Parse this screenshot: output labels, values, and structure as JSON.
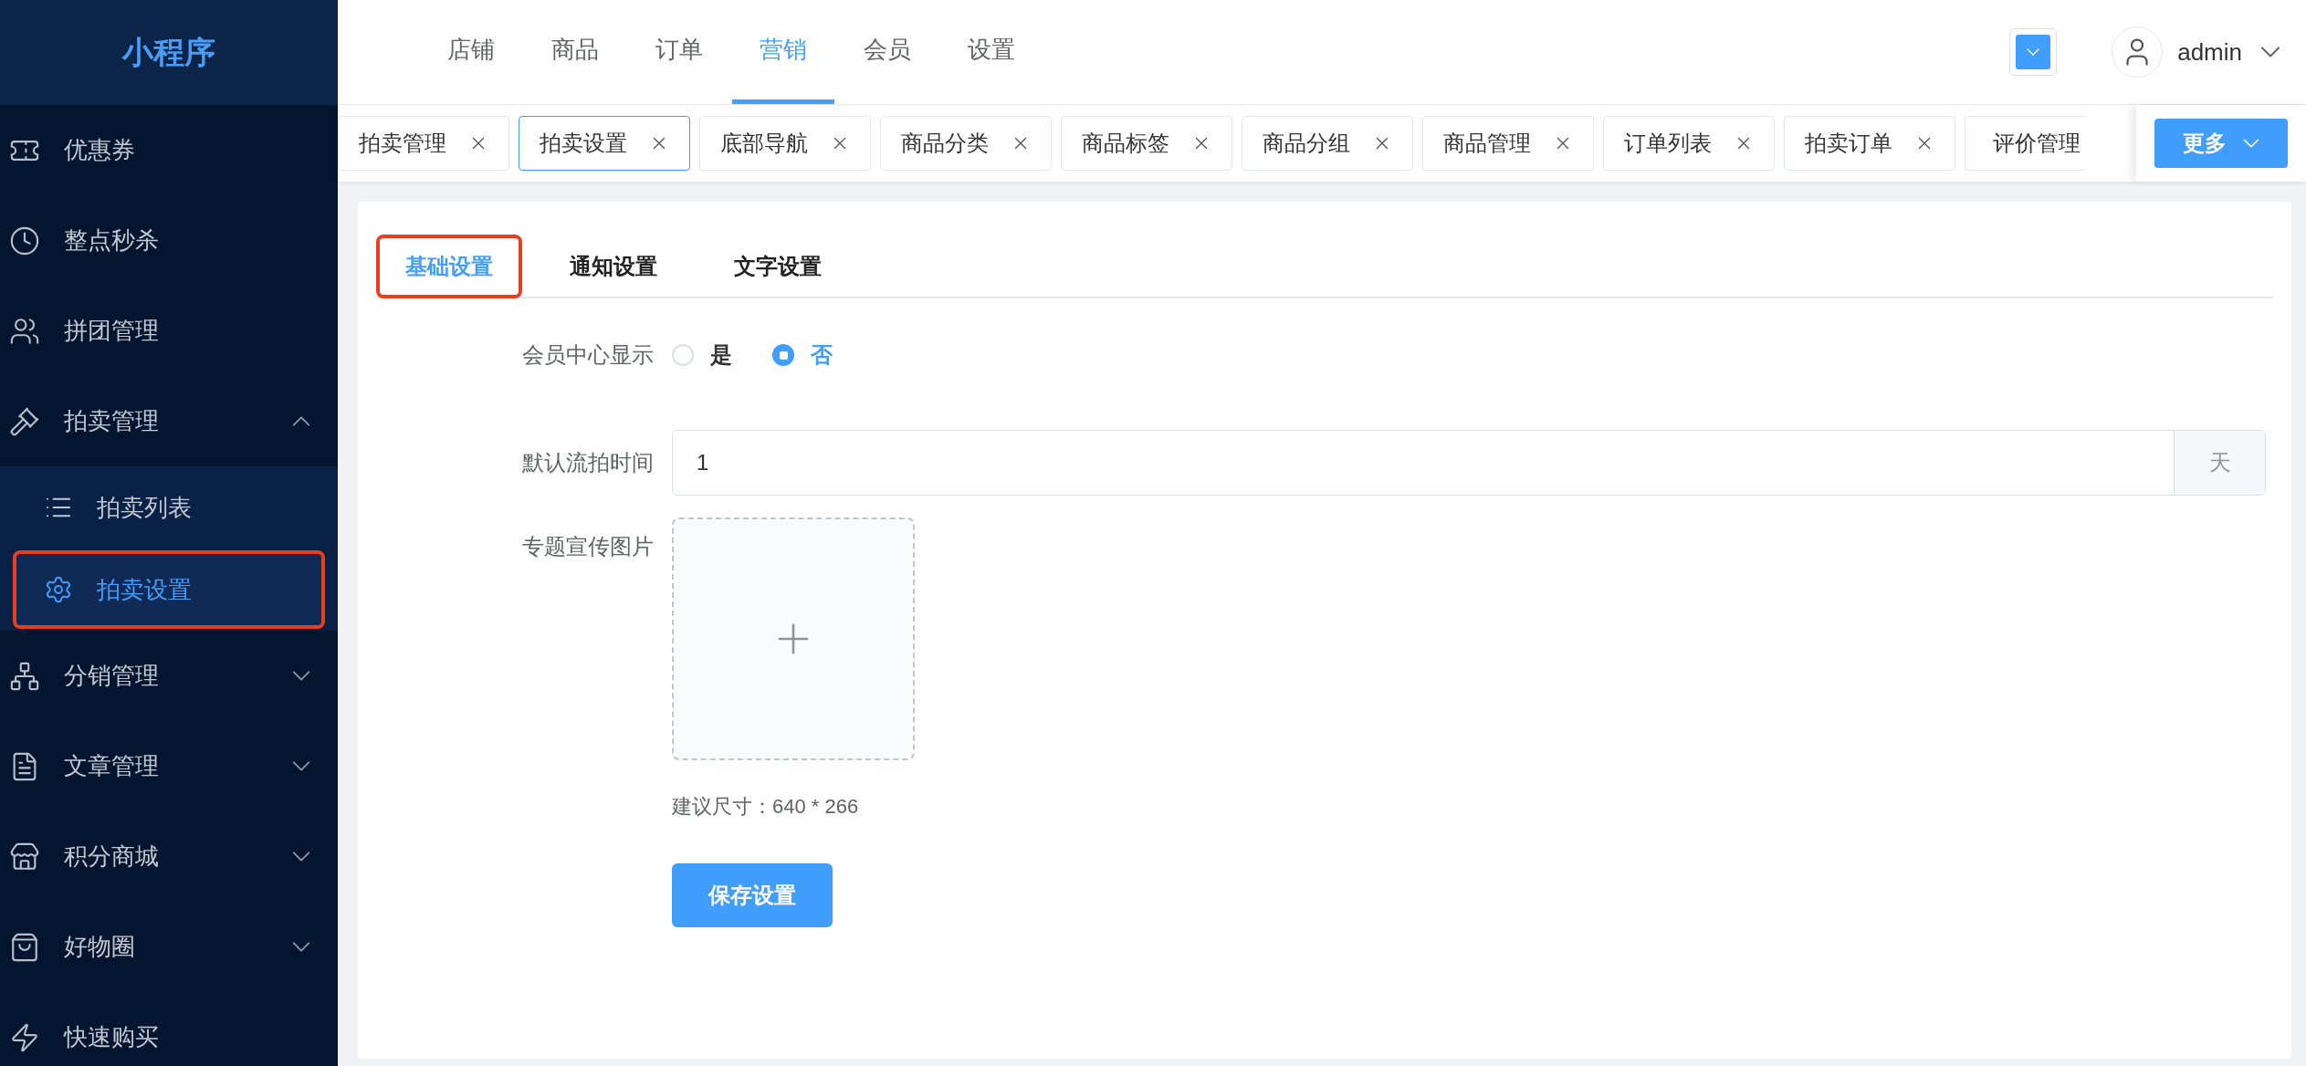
{
  "app": {
    "title": "小程序"
  },
  "sidebar": {
    "items": [
      {
        "label": "优惠券",
        "expandable": false
      },
      {
        "label": "整点秒杀",
        "expandable": false
      },
      {
        "label": "拼团管理",
        "expandable": false
      },
      {
        "label": "拍卖管理",
        "expanded": true,
        "expandable": true,
        "children": [
          {
            "label": "拍卖列表",
            "selected": false,
            "highlighted": false
          },
          {
            "label": "拍卖设置",
            "selected": true,
            "highlighted": true
          }
        ]
      },
      {
        "label": "分销管理",
        "expanded": false,
        "expandable": true
      },
      {
        "label": "文章管理",
        "expanded": false,
        "expandable": true
      },
      {
        "label": "积分商城",
        "expanded": false,
        "expandable": true
      },
      {
        "label": "好物圈",
        "expanded": false,
        "expandable": true
      },
      {
        "label": "快速购买",
        "expandable": false
      }
    ]
  },
  "top_nav": [
    {
      "label": "店铺",
      "selected": false
    },
    {
      "label": "商品",
      "selected": false
    },
    {
      "label": "订单",
      "selected": false
    },
    {
      "label": "营销",
      "selected": true
    },
    {
      "label": "会员",
      "selected": false
    },
    {
      "label": "设置",
      "selected": false
    }
  ],
  "user": {
    "name": "admin"
  },
  "open_tabs": [
    {
      "label": "拍卖管理",
      "selected": false
    },
    {
      "label": "拍卖设置",
      "selected": true
    },
    {
      "label": "底部导航",
      "selected": false
    },
    {
      "label": "商品分类",
      "selected": false
    },
    {
      "label": "商品标签",
      "selected": false
    },
    {
      "label": "商品分组",
      "selected": false
    },
    {
      "label": "商品管理",
      "selected": false
    },
    {
      "label": "订单列表",
      "selected": false
    },
    {
      "label": "拍卖订单",
      "selected": false
    },
    {
      "label": "评价管理",
      "selected": false
    }
  ],
  "more_button": "更多",
  "settings_tabs": [
    {
      "label": "基础设置",
      "selected": true,
      "highlighted": true
    },
    {
      "label": "通知设置",
      "selected": false,
      "highlighted": false
    },
    {
      "label": "文字设置",
      "selected": false,
      "highlighted": false
    }
  ],
  "form": {
    "member_center": {
      "label": "会员中心显示",
      "options": [
        {
          "label": "是",
          "selected": false
        },
        {
          "label": "否",
          "selected": true
        }
      ]
    },
    "default_time": {
      "label": "默认流拍时间",
      "value": "1",
      "unit": "天"
    },
    "banner": {
      "label": "专题宣传图片",
      "hint": "建议尺寸：640 * 266"
    },
    "save_button": "保存设置"
  }
}
